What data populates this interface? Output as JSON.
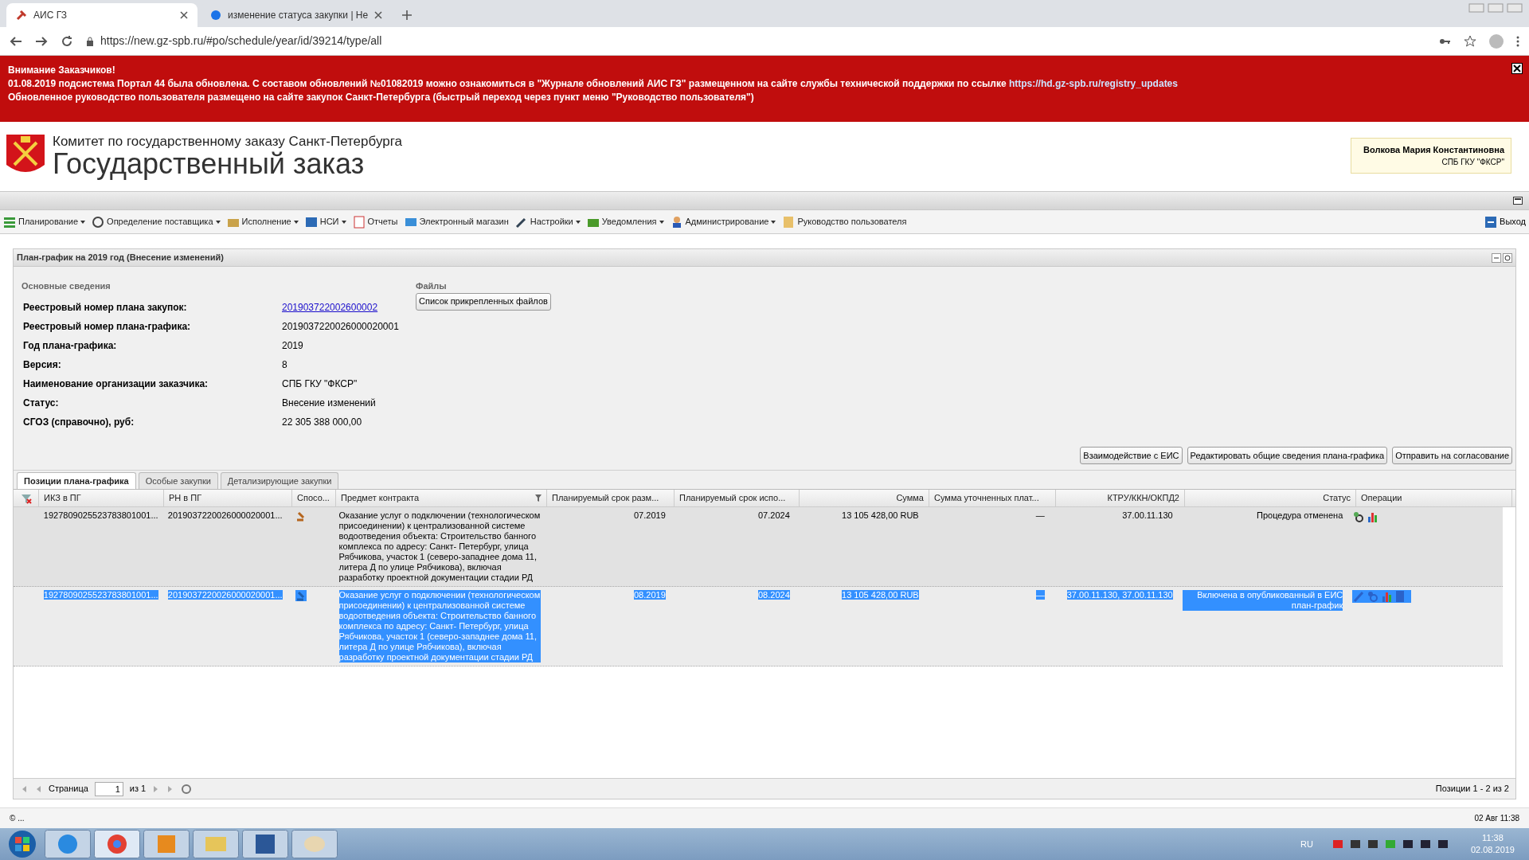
{
  "browser": {
    "tabs": [
      {
        "label": "АИС ГЗ",
        "selected": true
      },
      {
        "label": "изменение статуса закупки | Не",
        "selected": false
      }
    ],
    "url": "https://new.gz-spb.ru/#po/schedule/year/id/39214/type/all"
  },
  "banner": {
    "title": "Внимание Заказчиков!",
    "line_1": "01.08.2019 подсистема Портал 44 была обновлена. С составом обновлений №01082019 можно ознакомиться в \"Журнале обновлений АИС ГЗ\" размещенном на сайте службы технической поддержки по ссылке",
    "link": "https://hd.gz-spb.ru/registry_updates",
    "line_2": "Обновленное руководство пользователя размещено на сайте закупок Санкт-Петербурга (быстрый переход через пункт меню \"Руководство пользователя\")"
  },
  "header": {
    "subtitle": "Комитет по государственному заказу Санкт-Петербурга",
    "title": "Государственный заказ",
    "user_name": "Волкова Мария Константиновна",
    "user_org": "СПБ ГКУ \"ФКСР\""
  },
  "menu": [
    {
      "label": "Планирование",
      "has_menu": true
    },
    {
      "label": "Определение поставщика",
      "has_menu": true
    },
    {
      "label": "Исполнение",
      "has_menu": true
    },
    {
      "label": "НСИ",
      "has_menu": true
    },
    {
      "label": "Отчеты",
      "has_menu": false
    },
    {
      "label": "Электронный магазин",
      "has_menu": false
    },
    {
      "label": "Настройки",
      "has_menu": true
    },
    {
      "label": "Уведомления",
      "has_menu": true
    },
    {
      "label": "Администрирование",
      "has_menu": true
    },
    {
      "label": "Руководство пользователя",
      "has_menu": false
    }
  ],
  "exit": "Выход",
  "panel": {
    "title": "План-график на 2019 год (Внесение изменений)",
    "section": "Основные сведения",
    "files_label": "Файлы",
    "files_button": "Список прикрепленных файлов",
    "fields": [
      {
        "label": "Реестровый номер плана закупок:",
        "value": "201903722002600002",
        "kind": "link"
      },
      {
        "label": "Реестровый номер плана-графика:",
        "value": "2019037220026000020001",
        "kind": "text"
      },
      {
        "label": "Год плана-графика:",
        "value": "2019",
        "kind": "text"
      },
      {
        "label": "Версия:",
        "value": "8",
        "kind": "text"
      },
      {
        "label": "Наименование организации заказчика:",
        "value": "СПБ ГКУ \"ФКСР\"",
        "kind": "text"
      },
      {
        "label": "Статус:",
        "value": "Внесение изменений",
        "kind": "text"
      },
      {
        "label": "СГОЗ (справочно), руб:",
        "value": "22 305 388 000,00",
        "kind": "text"
      }
    ],
    "actions": [
      "Взаимодействие с ЕИС",
      "Редактировать общие сведения плана-графика",
      "Отправить на согласование"
    ]
  },
  "tabs": [
    {
      "label": "Позиции плана-графика",
      "selected": true
    },
    {
      "label": "Особые закупки",
      "selected": false
    },
    {
      "label": "Детализирующие закупки",
      "selected": false
    }
  ],
  "table": {
    "columns": [
      "ИКЗ в ПГ",
      "РН в ПГ",
      "Спосо...",
      "Предмет контракта",
      "Планируемый срок разм...",
      "Планируемый срок испо...",
      "Сумма",
      "Сумма уточненных плат...",
      "КТРУ/ККН/ОКПД2",
      "Статус",
      "Операции"
    ],
    "rows": [
      {
        "selected": false,
        "ikz": "1927809025523783801001...",
        "rn": "2019037220026000020001...",
        "subject": "Оказание услуг о подключении (технологическом присоединении) к централизованной системе водоотведения объекта: Строительство банного комплекса по адресу: Санкт- Петербург, улица Рябчикова, участок 1 (северо-западнее дома 11, литера Д по улице Рябчикова), включая разработку проектной документации стадии РД",
        "place": "07.2019",
        "exec": "07.2024",
        "sum": "13 105 428,00 RUB",
        "refined": "—",
        "ktru": "37.00.11.130",
        "status": "Процедура отменена"
      },
      {
        "selected": true,
        "ikz": "1927809025523783801001...",
        "rn": "2019037220026000020001...",
        "subject": "Оказание услуг о подключении (технологическом присоединении) к централизованной системе водоотведения объекта: Строительство банного комплекса по адресу: Санкт- Петербург, улица Рябчикова, участок 1 (северо-западнее дома 11, литера Д по улице Рябчикова), включая разработку проектной документации стадии РД",
        "place": "08.2019",
        "exec": "08.2024",
        "sum": "13 105 428,00 RUB",
        "refined": "—",
        "ktru": "37.00.11.130, 37.00.11.130",
        "status": "Включена в опубликованный в ЕИС план-график"
      }
    ]
  },
  "pager": {
    "page_label": "Страница",
    "page": "1",
    "of": "из 1",
    "summary": "Позиции 1 - 2 из 2"
  },
  "footer": {
    "left": "© ...",
    "right": "02 Авг 11:38"
  },
  "taskbar": {
    "lang": "RU",
    "time": "11:38",
    "date": "02.08.2019"
  }
}
